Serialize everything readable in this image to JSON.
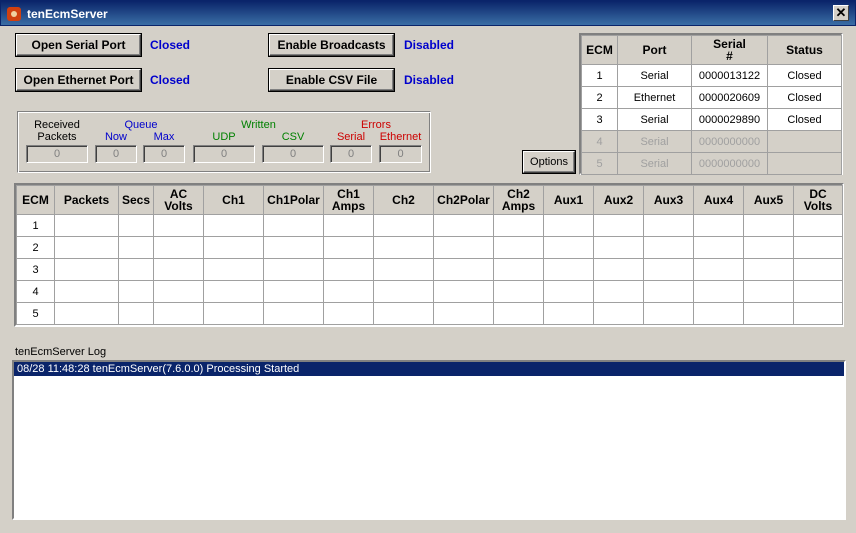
{
  "window": {
    "title": "tenEcmServer",
    "close_glyph": "✕"
  },
  "buttons": {
    "open_serial": "Open Serial Port",
    "open_ethernet": "Open Ethernet Port",
    "enable_broadcasts": "Enable Broadcasts",
    "enable_csv": "Enable CSV File",
    "options": "Options"
  },
  "status": {
    "serial": "Closed",
    "ethernet": "Closed",
    "broadcasts": "Disabled",
    "csv": "Disabled"
  },
  "stats": {
    "received_label": "Received",
    "packets_label": "Packets",
    "queue_label": "Queue",
    "now_label": "Now",
    "max_label": "Max",
    "written_label": "Written",
    "udp_label": "UDP",
    "csv_label": "CSV",
    "errors_label": "Errors",
    "serial_label": "Serial",
    "ethernet_label": "Ethernet",
    "received": "0",
    "now": "0",
    "max": "0",
    "udp": "0",
    "csv": "0",
    "err_serial": "0",
    "err_ethernet": "0"
  },
  "ecm_table": {
    "headers": [
      "ECM",
      "Port",
      "Serial #",
      "Status"
    ],
    "rows": [
      {
        "ecm": "1",
        "port": "Serial",
        "serial": "0000013122",
        "status": "Closed"
      },
      {
        "ecm": "2",
        "port": "Ethernet",
        "serial": "0000020609",
        "status": "Closed"
      },
      {
        "ecm": "3",
        "port": "Serial",
        "serial": "0000029890",
        "status": "Closed"
      },
      {
        "ecm": "4",
        "port": "Serial",
        "serial": "0000000000",
        "status": ""
      },
      {
        "ecm": "5",
        "port": "Serial",
        "serial": "0000000000",
        "status": ""
      }
    ]
  },
  "data_table": {
    "headers": [
      "ECM",
      "Packets",
      "Secs",
      "AC Volts",
      "Ch1",
      "Ch1Polar",
      "Ch1 Amps",
      "Ch2",
      "Ch2Polar",
      "Ch2 Amps",
      "Aux1",
      "Aux2",
      "Aux3",
      "Aux4",
      "Aux5",
      "DC Volts"
    ],
    "rows": [
      "1",
      "2",
      "3",
      "4",
      "5"
    ]
  },
  "log": {
    "label": "tenEcmServer Log",
    "lines": [
      "08/28 11:48:28 tenEcmServer(7.6.0.0) Processing Started"
    ]
  }
}
